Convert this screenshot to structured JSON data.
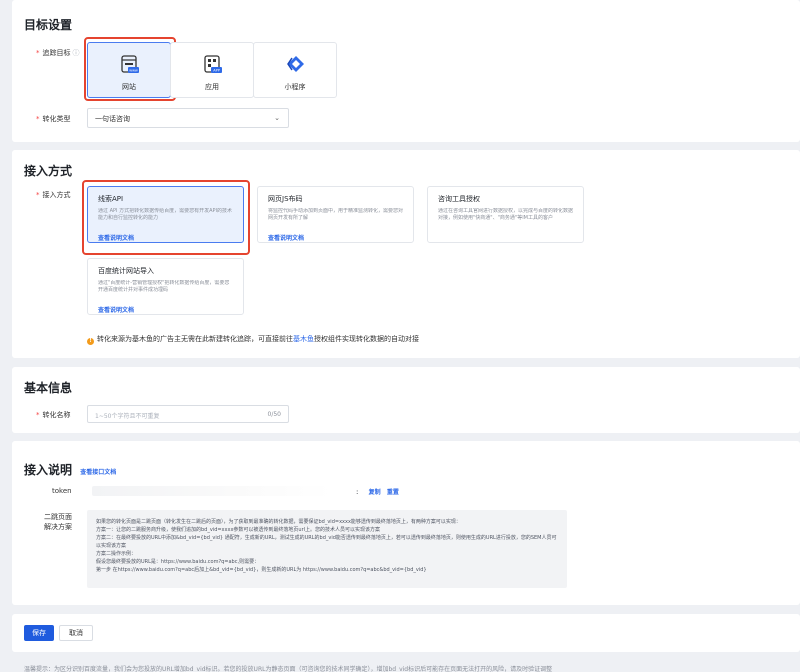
{
  "target_section": {
    "title": "目标设置",
    "tracking_label": "追踪目标",
    "tiles": [
      {
        "label": "网站",
        "badge": "www",
        "selected": true
      },
      {
        "label": "应用",
        "badge": "APP",
        "selected": false
      },
      {
        "label": "小程序",
        "selected": false
      }
    ],
    "conversion_type_label": "转化类型",
    "conversion_type_value": "一句话咨询"
  },
  "access_section": {
    "title": "接入方式",
    "label": "接入方式",
    "methods": [
      {
        "title": "线索API",
        "desc": "通过 API 方式把转化数据传给百度，需要您有开发API的技术能力和自行监控转化的能力",
        "link": "查看说明文档",
        "selected": true
      },
      {
        "title": "网页JS布码",
        "desc": "将监控代码手动添加到页面中，用于精准监测转化，需要您对网页开发有所了解",
        "link": "查看说明文档",
        "selected": false
      },
      {
        "title": "咨询工具授权",
        "desc": "通过在咨询工具官网进行数据授权，以完成与百度的转化数据对接，例如使用\"快商通\"、\"商务通\"等IM工具的客户",
        "link": "",
        "selected": false
      },
      {
        "title": "百度统计网站导入",
        "desc": "通过\"百度统计-营销管理授权\"把转化数据传给百度，需要您开通百度统计并对事件成功埋码",
        "link": "查看说明文档",
        "selected": false
      }
    ],
    "notice_prefix": "转化来源为基木鱼的广告主无需在此新建转化追踪，可直接前往",
    "notice_link": "基木鱼",
    "notice_suffix": "授权组件实现转化数据的自动对接"
  },
  "basic_section": {
    "title": "基本信息",
    "name_label": "转化名称",
    "name_placeholder": "1~50个字符且不可重复",
    "name_count": "0/50"
  },
  "instructions_section": {
    "title": "接入说明",
    "doc_link": "查看接口文档",
    "token_label": "token",
    "token_colon": ":",
    "copy_label": "复制",
    "reset_label": "重置",
    "second_page_label_1": "二跳页面",
    "second_page_label_2": "解决方案",
    "code_lines": [
      "如果您的转化页面是二跳页面（转化发生在二跳后的页面），为了获取到最准确的转化数据，需要保证bd_vid=xxxx能够透传到最终落地页上，有两种方案可以实现：",
      "方案一：让您的二跳服务商升级，使我们追加的bd_vid=xxxx参数可以被透传到最终落地页url上。您的技术人员可以实现该方案",
      "方案二：在最终要投放的URL中添加&bd_vid={bd_vid} 通配符，生成新的URL，测试生成的URL的bd_vid能否透传到最终落地页上，若可以透传到最终落地页，则使用生成的URL进行投放，您的SEM人员可以实现该方案",
      "方案二操作示例：",
      "假设您最终要投放的URL是：https://www.baidu.com?q=abc,则需要：",
      "第一步 在https://www.baidu.com?q=abc后加上&bd_vid={bd_vid}，则生成新的URL为 https://www.baidu.com?q=abc&bd_vid={bd_vid}"
    ]
  },
  "actions": {
    "save_label": "保存",
    "cancel_label": "取消"
  },
  "footer": {
    "text": "温馨提示：为区分识别百度流量，我们会为您投放的URL增加bd_vid标识。若您的投放URL为静态页面（可咨询您的技术同学确定），增加bd_vid标识后可能存在页面无法打开的风险，请及时验证调整"
  },
  "colors": {
    "primary": "#1f5bde",
    "highlight_box": "#e5442f",
    "selected_bg": "#eaf1fd",
    "link": "#2f6ae8",
    "warning": "#f39b1b"
  }
}
